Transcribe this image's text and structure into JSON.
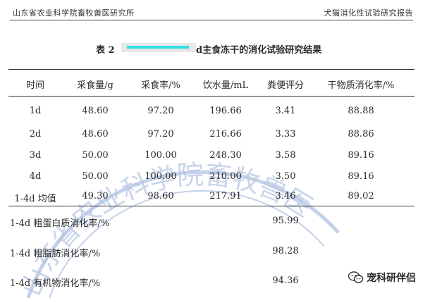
{
  "header": {
    "left": "山东省农业科学院畜牧兽医研究所",
    "right": "犬猫消化性试验研究报告"
  },
  "title": {
    "label": "表 2",
    "rest": "d主食冻干的消化试验研究结果"
  },
  "table": {
    "columns": [
      "时间",
      "采食量/g",
      "采食率/%",
      "饮水量/mL",
      "粪便评分",
      "干物质消化率/%"
    ],
    "rows": [
      [
        "1d",
        "48.60",
        "97.20",
        "196.66",
        "3.41",
        "88.88"
      ],
      [
        "2d",
        "48.60",
        "97.20",
        "216.66",
        "3.33",
        "88.86"
      ],
      [
        "3d",
        "50.00",
        "100.00",
        "248.30",
        "3.58",
        "89.16"
      ],
      [
        "4d",
        "50.00",
        "100.00",
        "210.00",
        "3.50",
        "89.16"
      ],
      [
        "1-4d 均值",
        "49.30",
        "98.60",
        "217.91",
        "3.46",
        "89.02"
      ]
    ],
    "summary": [
      {
        "label": "1-4d 粗蛋白质消化率/%",
        "value": "95.99"
      },
      {
        "label": "1-4d 粗脂肪消化率/%",
        "value": "98.28"
      },
      {
        "label": "1-4d 有机物消化率/%",
        "value": "94.36"
      }
    ]
  },
  "watermark": {
    "text": "山东省农业科学院畜牧兽医",
    "color": "#b7c7e3"
  },
  "wechat": {
    "icon": "wechat-icon",
    "text": "宠科研伴侣"
  },
  "redaction_color": "#2ee0e6"
}
